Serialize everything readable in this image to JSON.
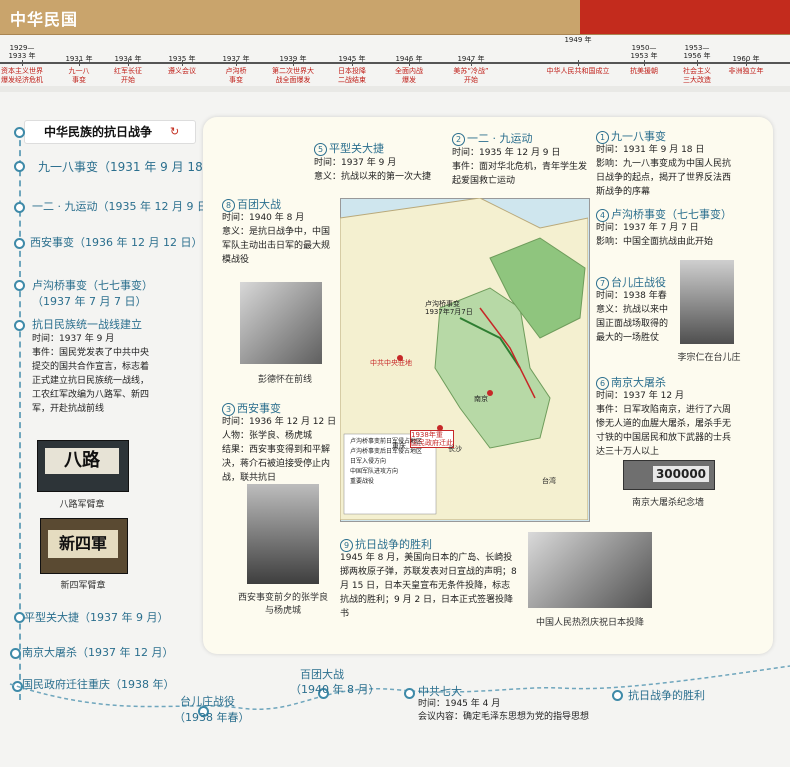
{
  "header": {
    "title": "中华民国"
  },
  "timeline": [
    {
      "year": "1929—\n1933 年",
      "event": "资本主义世界\n爆发经济危机"
    },
    {
      "year": "1931 年",
      "event": "九一八\n事变"
    },
    {
      "year": "1934 年",
      "event": "红军长征\n开始"
    },
    {
      "year": "1935 年",
      "event": "遵义会议"
    },
    {
      "year": "1937 年",
      "event": "卢沟桥\n事变"
    },
    {
      "year": "1939 年",
      "event": "第二次世界大\n战全面爆发"
    },
    {
      "year": "1945 年",
      "event": "日本投降\n二战结束"
    },
    {
      "year": "1946 年",
      "event": "全面内战\n爆发"
    },
    {
      "year": "1947 年",
      "event": "美苏“冷战”\n开始"
    },
    {
      "year": "1949 年",
      "event": "中华人民共和国成立"
    },
    {
      "year": "1950—\n1953 年",
      "event": "抗美援朝"
    },
    {
      "year": "1953—\n1956 年",
      "event": "社会主义\n三大改造"
    },
    {
      "year": "1960 年",
      "event": "非洲独立年"
    }
  ],
  "section_title": "中华民族的抗日战争",
  "left_events": {
    "e1": "九一八事变（1931 年 9 月 18 日）",
    "e2": "一二 · 九运动（1935 年 12 月 9 日）",
    "e3": "西安事变（1936 年 12 月 12 日）",
    "e4a": "卢沟桥事变（七七事变）",
    "e4b": "（1937 年 7 月 7 日）",
    "e5": "抗日民族统一战线建立",
    "e5_time": "时间：1937 年 9 月",
    "e5_ev": "事件：国民党发表了中共中央提交的国共合作宣言，标志着正式建立抗日民族统一战线，工农红军改编为八路军、新四军，开赴抗战前线",
    "badge1": "八路",
    "badge1_cap": "八路军臂章",
    "badge2": "新四軍",
    "badge2_cap": "新四军臂章",
    "e6": "平型关大捷（1937 年 9 月）",
    "e7": "南京大屠杀（1937 年 12 月）",
    "e8": "国民政府迁往重庆（1938 年）"
  },
  "bottom": {
    "b1a": "台儿庄战役",
    "b1b": "（1938 年春）",
    "b2a": "百团大战",
    "b2b": "（1940 年 8 月）",
    "b3": "中共七大",
    "b3_time": "时间：1945 年 4 月",
    "b3_content": "会议内容：确定毛泽东思想为党的指导思想",
    "b4": "抗日战争的胜利"
  },
  "blocks": {
    "p5": {
      "num": "5",
      "title": "平型关大捷",
      "time": "时间：1937 年 9 月",
      "meaning": "意义：抗战以来的第一次大捷"
    },
    "p2": {
      "num": "2",
      "title": "一二 · 九运动",
      "time": "时间：1935 年 12 月 9 日",
      "event": "事件：面对华北危机，青年学生发起爱国救亡运动"
    },
    "p1": {
      "num": "1",
      "title": "九一八事变",
      "time": "时间：1931 年 9 月 18 日",
      "impact": "影响：九一八事变成为中国人民抗日战争的起点，揭开了世界反法西斯战争的序幕"
    },
    "p8": {
      "num": "8",
      "title": "百团大战",
      "time": "时间：1940 年 8 月",
      "meaning": "意义：是抗日战争中，中国军队主动出击日军的最大规模战役",
      "cap": "彭德怀在前线"
    },
    "p4": {
      "num": "4",
      "title": "卢沟桥事变（七七事变）",
      "time": "时间：1937 年 7 月 7 日",
      "impact": "影响：中国全面抗战由此开始"
    },
    "p7": {
      "num": "7",
      "title": "台儿庄战役",
      "time": "时间：1938 年春",
      "meaning": "意义：抗战以来中国正面战场取得的最大的一场胜仗",
      "cap": "李宗仁在台儿庄"
    },
    "p3": {
      "num": "3",
      "title": "西安事变",
      "time": "时间：1936 年 12 月 12 日",
      "people": "人物：张学良、杨虎城",
      "result": "结果：西安事变得到和平解决，蒋介石被迫接受停止内战，联共抗日",
      "cap": "西安事变前夕的张学良与杨虎城"
    },
    "p6": {
      "num": "6",
      "title": "南京大屠杀",
      "time": "时间：1937 年 12 月",
      "event": "事件：日军攻陷南京，进行了六周惨无人道的血腥大屠杀，屠杀手无寸铁的中国居民和放下武器的士兵达三十万人以上",
      "wall": "300000",
      "cap": "南京大屠杀纪念墙"
    },
    "p9": {
      "num": "9",
      "title": "抗日战争的胜利",
      "text": "1945 年 8 月，美国向日本的广岛、长崎投掷两枚原子弹，苏联发表对日宣战的声明；8 月 15 日，日本天皇宣布无条件投降，标志抗战的胜利；9 月 2 日，日本正式签署投降书",
      "cap": "中国人民热烈庆祝日本投降"
    }
  },
  "map": {
    "labels": [
      "卢沟桥事变\n1937年7月7日",
      "中共中央驻地",
      "1938年重\n国民政府迁此",
      "重庆",
      "南京",
      "长沙",
      "台湾"
    ],
    "legend": [
      "卢沟桥事变前日军侵占地区",
      "卢沟桥事变后日军侵占地区",
      "日军入侵方向",
      "中国军队进攻方向",
      "重要战役"
    ]
  },
  "colors": {
    "accent": "#2b6f8e",
    "header": "#c9a46c",
    "red": "#c32b1d"
  }
}
